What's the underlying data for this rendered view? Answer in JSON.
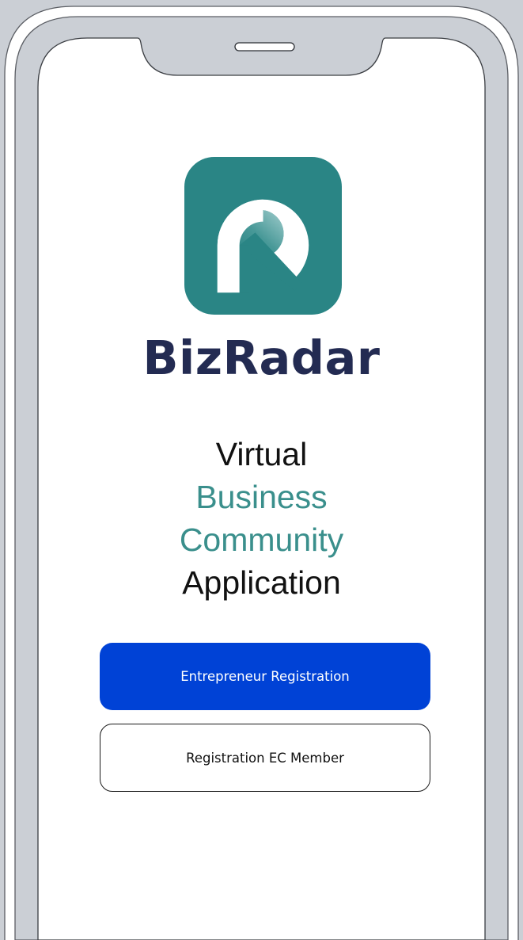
{
  "brand": {
    "name": "BizRadar"
  },
  "tagline": {
    "line1": "Virtual",
    "line2": "Business",
    "line3": "Community",
    "line4": "Application"
  },
  "buttons": {
    "primary_label": "Entrepreneur Registration",
    "secondary_label": "Registration EC Member"
  },
  "icons": {
    "logo": "bizradar-logo-icon"
  },
  "colors": {
    "frame_gray": "#cbcfd5",
    "teal": "#2a8585",
    "teal_light": "#8fc3c3",
    "navy": "#232b52",
    "tagline_dark": "#111111",
    "tagline_teal": "#3a8f8c",
    "primary_button_bg": "#0042d6",
    "primary_button_text": "#ffffff",
    "secondary_button_text": "#111111",
    "screen_bg": "#ffffff"
  }
}
